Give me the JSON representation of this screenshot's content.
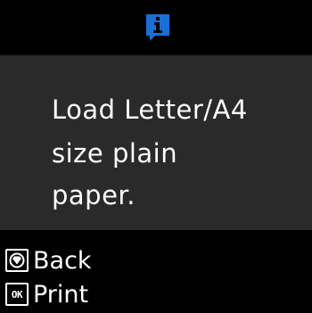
{
  "header": {
    "icon": "info-icon",
    "icon_glyph": "i",
    "icon_color": "#1a6fd6"
  },
  "message": {
    "lines": [
      "Load Letter/A4",
      "size plain",
      "paper."
    ]
  },
  "actions": {
    "back": {
      "icon": "stop-icon",
      "label": "Back"
    },
    "print": {
      "icon": "ok-icon",
      "icon_text": "OK",
      "label": "Print"
    }
  },
  "colors": {
    "background": "#000000",
    "panel": "#2a2a2a",
    "text": "#ffffff",
    "accent": "#1a6fd6"
  }
}
